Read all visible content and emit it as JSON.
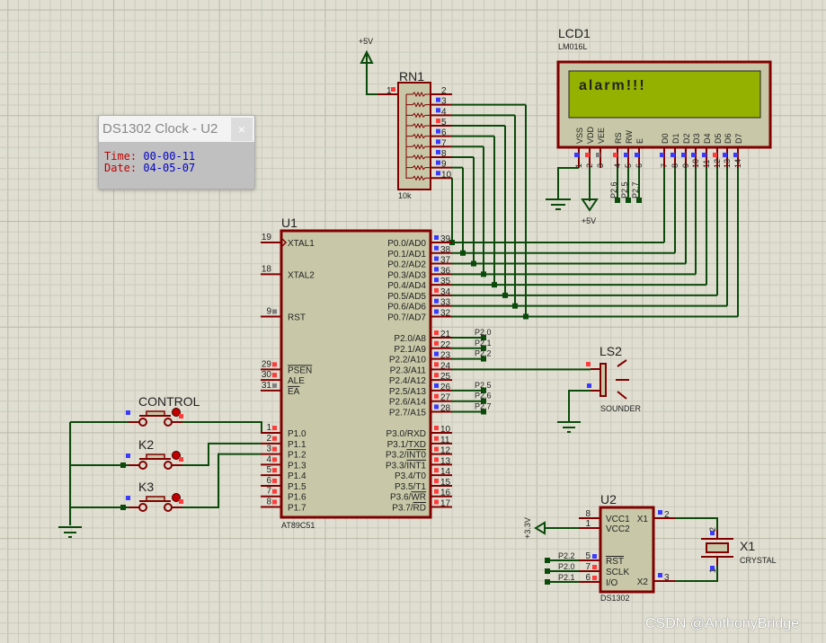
{
  "colors": {
    "wire": "#0b4a0b",
    "pin": "#800000",
    "body": "#c8c8a8",
    "outline": "#800000",
    "lcd_screen": "#94b100",
    "state_high": "#ff3b3b",
    "state_low": "#3b3bff",
    "state_float": "#808080"
  },
  "u1": {
    "ref": "U1",
    "part": "AT89C51",
    "left_pins": [
      {
        "row": 0,
        "num": "19",
        "name": "XTAL1",
        "state": "none"
      },
      {
        "row": 3,
        "num": "18",
        "name": "XTAL2",
        "state": "none"
      },
      {
        "row": 7,
        "num": "9",
        "name": "RST",
        "state": "float"
      },
      {
        "row": 12,
        "num": "29",
        "name": "PSEN",
        "bar": true,
        "state": "high"
      },
      {
        "row": 13,
        "num": "30",
        "name": "ALE",
        "state": "high"
      },
      {
        "row": 14,
        "num": "31",
        "name": "EA",
        "bar": true,
        "state": "float"
      },
      {
        "row": 18,
        "num": "1",
        "name": "P1.0",
        "state": "high"
      },
      {
        "row": 19,
        "num": "2",
        "name": "P1.1",
        "state": "high"
      },
      {
        "row": 20,
        "num": "3",
        "name": "P1.2",
        "state": "high"
      },
      {
        "row": 21,
        "num": "4",
        "name": "P1.3",
        "state": "high"
      },
      {
        "row": 22,
        "num": "5",
        "name": "P1.4",
        "state": "high"
      },
      {
        "row": 23,
        "num": "6",
        "name": "P1.5",
        "state": "high"
      },
      {
        "row": 24,
        "num": "7",
        "name": "P1.6",
        "state": "high"
      },
      {
        "row": 25,
        "num": "8",
        "name": "P1.7",
        "state": "high"
      }
    ],
    "right_pins": [
      {
        "row": 0,
        "num": "39",
        "name": "P0.0/AD0",
        "state": "low"
      },
      {
        "row": 1,
        "num": "38",
        "name": "P0.1/AD1",
        "state": "low"
      },
      {
        "row": 2,
        "num": "37",
        "name": "P0.2/AD2",
        "state": "low"
      },
      {
        "row": 3,
        "num": "36",
        "name": "P0.3/AD3",
        "state": "low"
      },
      {
        "row": 4,
        "num": "35",
        "name": "P0.4/AD4",
        "state": "low"
      },
      {
        "row": 5,
        "num": "34",
        "name": "P0.5/AD5",
        "state": "high"
      },
      {
        "row": 6,
        "num": "33",
        "name": "P0.6/AD6",
        "state": "low"
      },
      {
        "row": 7,
        "num": "32",
        "name": "P0.7/AD7",
        "state": "low"
      },
      {
        "row": 9,
        "num": "21",
        "name": "P2.0/A8",
        "state": "high"
      },
      {
        "row": 10,
        "num": "22",
        "name": "P2.1/A9",
        "state": "high"
      },
      {
        "row": 11,
        "num": "23",
        "name": "P2.2/A10",
        "state": "low"
      },
      {
        "row": 12,
        "num": "24",
        "name": "P2.3/A11",
        "state": "high"
      },
      {
        "row": 13,
        "num": "25",
        "name": "P2.4/A12",
        "state": "high"
      },
      {
        "row": 14,
        "num": "26",
        "name": "P2.5/A13",
        "state": "low"
      },
      {
        "row": 15,
        "num": "27",
        "name": "P2.6/A14",
        "state": "high"
      },
      {
        "row": 16,
        "num": "28",
        "name": "P2.7/A15",
        "state": "low"
      },
      {
        "row": 18,
        "num": "10",
        "name": "P3.0/RXD",
        "state": "high"
      },
      {
        "row": 19,
        "num": "11",
        "name": "P3.1/TXD",
        "state": "high"
      },
      {
        "row": 20,
        "num": "12",
        "name": "P3.2/INT0",
        "bar_part": "INT0",
        "state": "high"
      },
      {
        "row": 21,
        "num": "13",
        "name": "P3.3/INT1",
        "bar_part": "INT1",
        "state": "high"
      },
      {
        "row": 22,
        "num": "14",
        "name": "P3.4/T0",
        "state": "high"
      },
      {
        "row": 23,
        "num": "15",
        "name": "P3.5/T1",
        "state": "high"
      },
      {
        "row": 24,
        "num": "16",
        "name": "P3.6/WR",
        "bar_part": "WR",
        "state": "high"
      },
      {
        "row": 25,
        "num": "17",
        "name": "P3.7/RD",
        "bar_part": "RD",
        "state": "high"
      }
    ]
  },
  "p2_net_labels": [
    {
      "row": 9,
      "label": "P2.0"
    },
    {
      "row": 10,
      "label": "P2.1"
    },
    {
      "row": 11,
      "label": "P2.2"
    },
    {
      "row": 14,
      "label": "P2.5"
    },
    {
      "row": 15,
      "label": "P2.6"
    },
    {
      "row": 16,
      "label": "P2.7"
    }
  ],
  "lcd": {
    "ref": "LCD1",
    "part": "LM016L",
    "display_text": "alarm!!!",
    "pins": [
      {
        "num": "1",
        "name": "VSS",
        "state": "low"
      },
      {
        "num": "2",
        "name": "VDD",
        "state": "high"
      },
      {
        "num": "3",
        "name": "VEE",
        "state": "float"
      },
      {
        "num": "4",
        "name": "RS",
        "state": "high",
        "net": "P2.6"
      },
      {
        "num": "5",
        "name": "RW",
        "state": "low",
        "net": "P2.5"
      },
      {
        "num": "6",
        "name": "E",
        "state": "low",
        "net": "P2.7"
      },
      {
        "num": "7",
        "name": "D0",
        "state": "low"
      },
      {
        "num": "8",
        "name": "D1",
        "state": "low"
      },
      {
        "num": "9",
        "name": "D2",
        "state": "low"
      },
      {
        "num": "10",
        "name": "D3",
        "state": "low"
      },
      {
        "num": "11",
        "name": "D4",
        "state": "low"
      },
      {
        "num": "12",
        "name": "D5",
        "state": "high"
      },
      {
        "num": "13",
        "name": "D6",
        "state": "low"
      },
      {
        "num": "14",
        "name": "D7",
        "state": "low"
      }
    ],
    "vdd_label": "+5V"
  },
  "rn1": {
    "ref": "RN1",
    "value": "10k",
    "supply_label": "+5V",
    "pins": [
      {
        "num": "1",
        "state": "high"
      },
      {
        "num": "2",
        "state": "none"
      },
      {
        "num": "3",
        "state": "low"
      },
      {
        "num": "4",
        "state": "low"
      },
      {
        "num": "5",
        "state": "high"
      },
      {
        "num": "6",
        "state": "low"
      },
      {
        "num": "7",
        "state": "low"
      },
      {
        "num": "8",
        "state": "low"
      },
      {
        "num": "9",
        "state": "low"
      },
      {
        "num": "10",
        "state": "low"
      }
    ]
  },
  "buttons": [
    {
      "label": "CONTROL"
    },
    {
      "label": "K2"
    },
    {
      "label": "K3"
    }
  ],
  "ls2": {
    "ref": "LS2",
    "part": "SOUNDER"
  },
  "u2": {
    "ref": "U2",
    "part": "DS1302",
    "supply_label": "+3.3V",
    "left_pins": [
      {
        "num": "8",
        "name": "VCC1",
        "state": "none"
      },
      {
        "num": "1",
        "name": "VCC2",
        "state": "none"
      },
      {
        "num": "5",
        "name": "RST",
        "bar": true,
        "state": "low",
        "net": "P2.2"
      },
      {
        "num": "7",
        "name": "SCLK",
        "state": "high",
        "net": "P2.0"
      },
      {
        "num": "6",
        "name": "I/O",
        "state": "high",
        "net": "P2.1"
      }
    ],
    "right_pins": [
      {
        "num": "2",
        "name": "X1",
        "state": "low"
      },
      {
        "num": "3",
        "name": "X2",
        "state": "low"
      }
    ]
  },
  "x1": {
    "ref": "X1",
    "part": "CRYSTAL",
    "pins": [
      {
        "num": "2",
        "state": "low"
      },
      {
        "num": "1",
        "state": "low"
      }
    ]
  },
  "popup": {
    "title": "DS1302 Clock - U2",
    "close": "×",
    "time_label": "Time:",
    "time_value": "00-00-11",
    "date_label": "Date:",
    "date_value": "04-05-07"
  },
  "watermark": "CSDN @AnthonyBridge"
}
